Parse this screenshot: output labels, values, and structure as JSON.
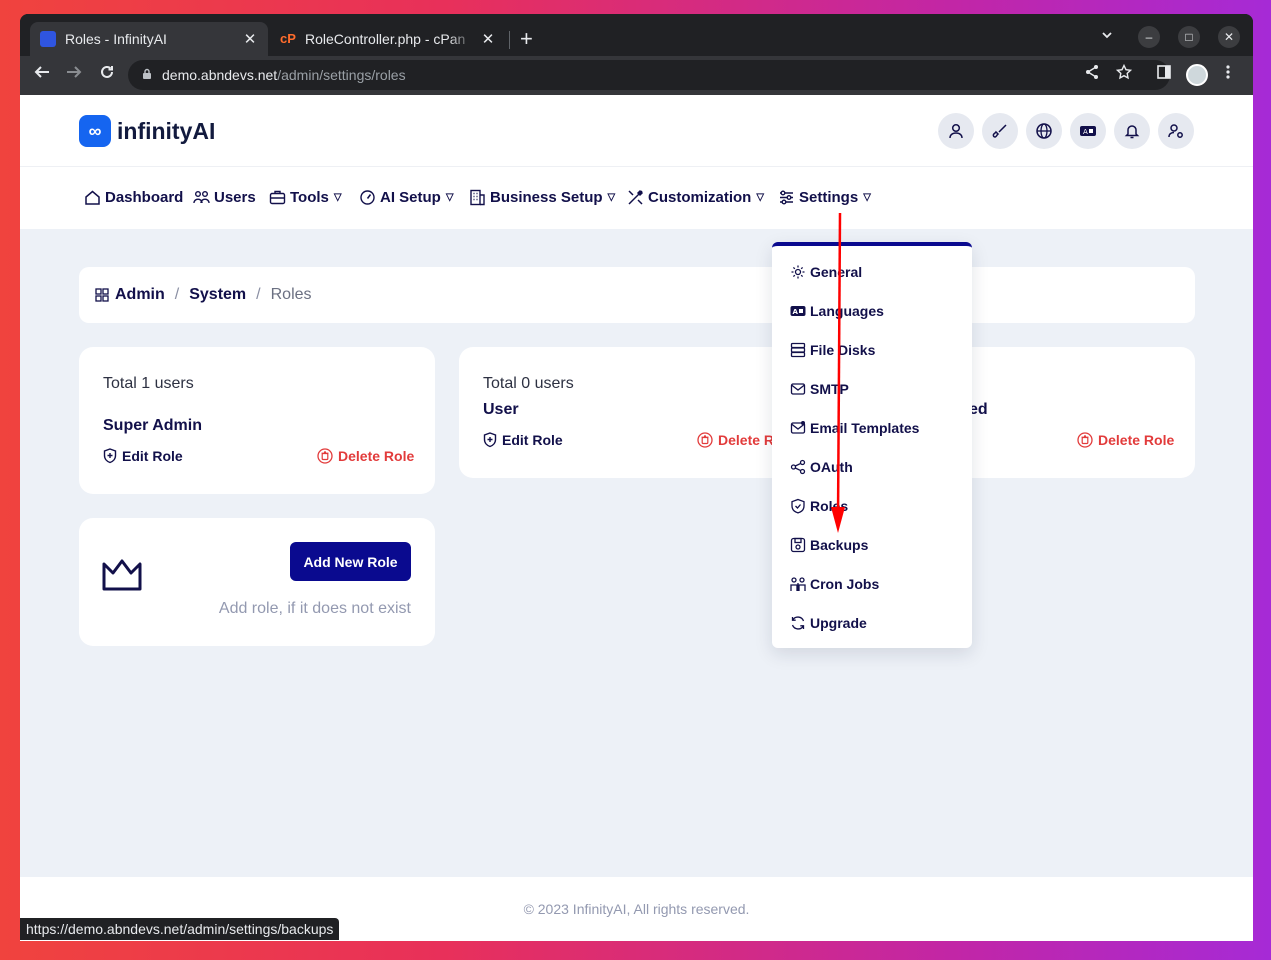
{
  "browser": {
    "tabs": [
      {
        "title": "Roles - InfinityAI",
        "close": "✕"
      },
      {
        "title": "RoleController.php - cPan",
        "close": "✕"
      }
    ],
    "new_tab": "+",
    "url_host": "demo.abndevs.net",
    "url_path": "/admin/settings/roles",
    "status_url": "https://demo.abndevs.net/admin/settings/backups"
  },
  "app": {
    "logo_text": "infinityAI",
    "logo_mark": "∞",
    "header_icons": [
      "user-icon",
      "brush-icon",
      "globe-icon",
      "language-icon",
      "bell-icon",
      "user-settings-icon"
    ]
  },
  "nav": {
    "items": [
      {
        "label": "Dashboard",
        "icon": "home-icon",
        "dropdown": false
      },
      {
        "label": "Users",
        "icon": "users-icon",
        "dropdown": false
      },
      {
        "label": "Tools",
        "icon": "briefcase-icon",
        "dropdown": true
      },
      {
        "label": "AI Setup",
        "icon": "gauge-icon",
        "dropdown": true
      },
      {
        "label": "Business Setup",
        "icon": "building-icon",
        "dropdown": true
      },
      {
        "label": "Customization",
        "icon": "tools-icon",
        "dropdown": true
      },
      {
        "label": "Settings",
        "icon": "sliders-icon",
        "dropdown": true
      }
    ]
  },
  "breadcrumb": {
    "items": [
      "Admin",
      "System",
      "Roles"
    ],
    "separator": "/"
  },
  "roles": [
    {
      "total": "Total 1 users",
      "name": "Super Admin",
      "edit": "Edit Role",
      "delete": "Delete Role"
    },
    {
      "total": "Total 0 users",
      "name": "User",
      "edit": "Edit Role",
      "delete": "Delete Role"
    },
    {
      "name_visible_part": "ed",
      "delete": "Delete Role"
    }
  ],
  "add_card": {
    "button": "Add New Role",
    "hint": "Add role, if it does not exist",
    "icon": "crown-icon"
  },
  "settings_menu": {
    "items": [
      {
        "label": "General",
        "icon": "gear-icon"
      },
      {
        "label": "Languages",
        "icon": "language-icon"
      },
      {
        "label": "File Disks",
        "icon": "server-icon"
      },
      {
        "label": "SMTP",
        "icon": "mail-icon"
      },
      {
        "label": "Email Templates",
        "icon": "mail-template-icon"
      },
      {
        "label": "OAuth",
        "icon": "share-icon"
      },
      {
        "label": "Roles",
        "icon": "shield-icon"
      },
      {
        "label": "Backups",
        "icon": "save-icon"
      },
      {
        "label": "Cron Jobs",
        "icon": "people-icon"
      },
      {
        "label": "Upgrade",
        "icon": "refresh-icon"
      }
    ]
  },
  "footer": {
    "text": "© 2023 InfinityAI, All rights reserved."
  },
  "colors": {
    "primary": "#0a0a8f",
    "danger": "#e23b3b",
    "text_dark": "#12104a",
    "page_bg": "#edf1f7"
  }
}
